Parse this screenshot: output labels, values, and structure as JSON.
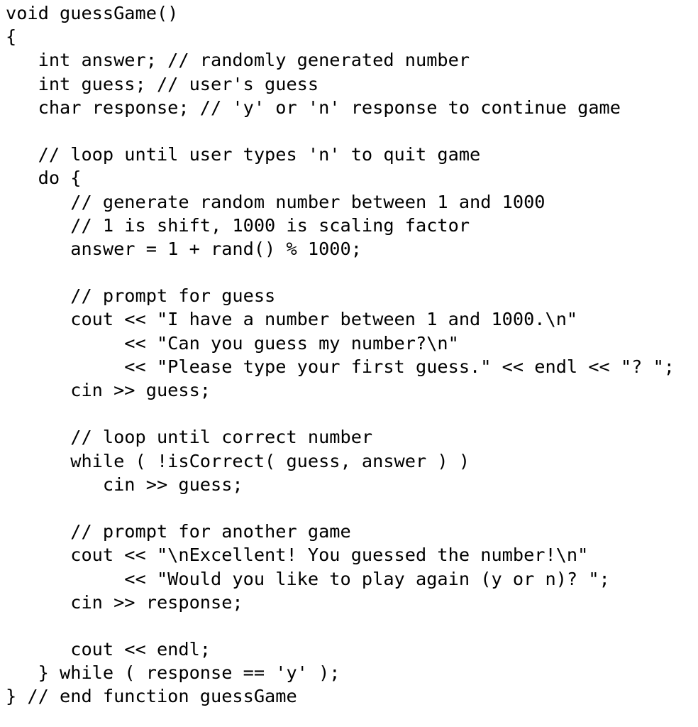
{
  "document": {
    "language": "C++",
    "text_color": "#000000",
    "background_color": "#ffffff",
    "lines": [
      "void guessGame()",
      "{",
      "   int answer; // randomly generated number",
      "   int guess; // user's guess",
      "   char response; // 'y' or 'n' response to continue game",
      "",
      "   // loop until user types 'n' to quit game",
      "   do {",
      "      // generate random number between 1 and 1000",
      "      // 1 is shift, 1000 is scaling factor",
      "      answer = 1 + rand() % 1000;",
      "",
      "      // prompt for guess",
      "      cout << \"I have a number between 1 and 1000.\\n\"",
      "           << \"Can you guess my number?\\n\"",
      "           << \"Please type your first guess.\" << endl << \"? \";",
      "      cin >> guess;",
      "",
      "      // loop until correct number",
      "      while ( !isCorrect( guess, answer ) )",
      "         cin >> guess;",
      "",
      "      // prompt for another game",
      "      cout << \"\\nExcellent! You guessed the number!\\n\"",
      "           << \"Would you like to play again (y or n)? \";",
      "      cin >> response;",
      "",
      "      cout << endl;",
      "   } while ( response == 'y' );",
      "} // end function guessGame"
    ]
  }
}
